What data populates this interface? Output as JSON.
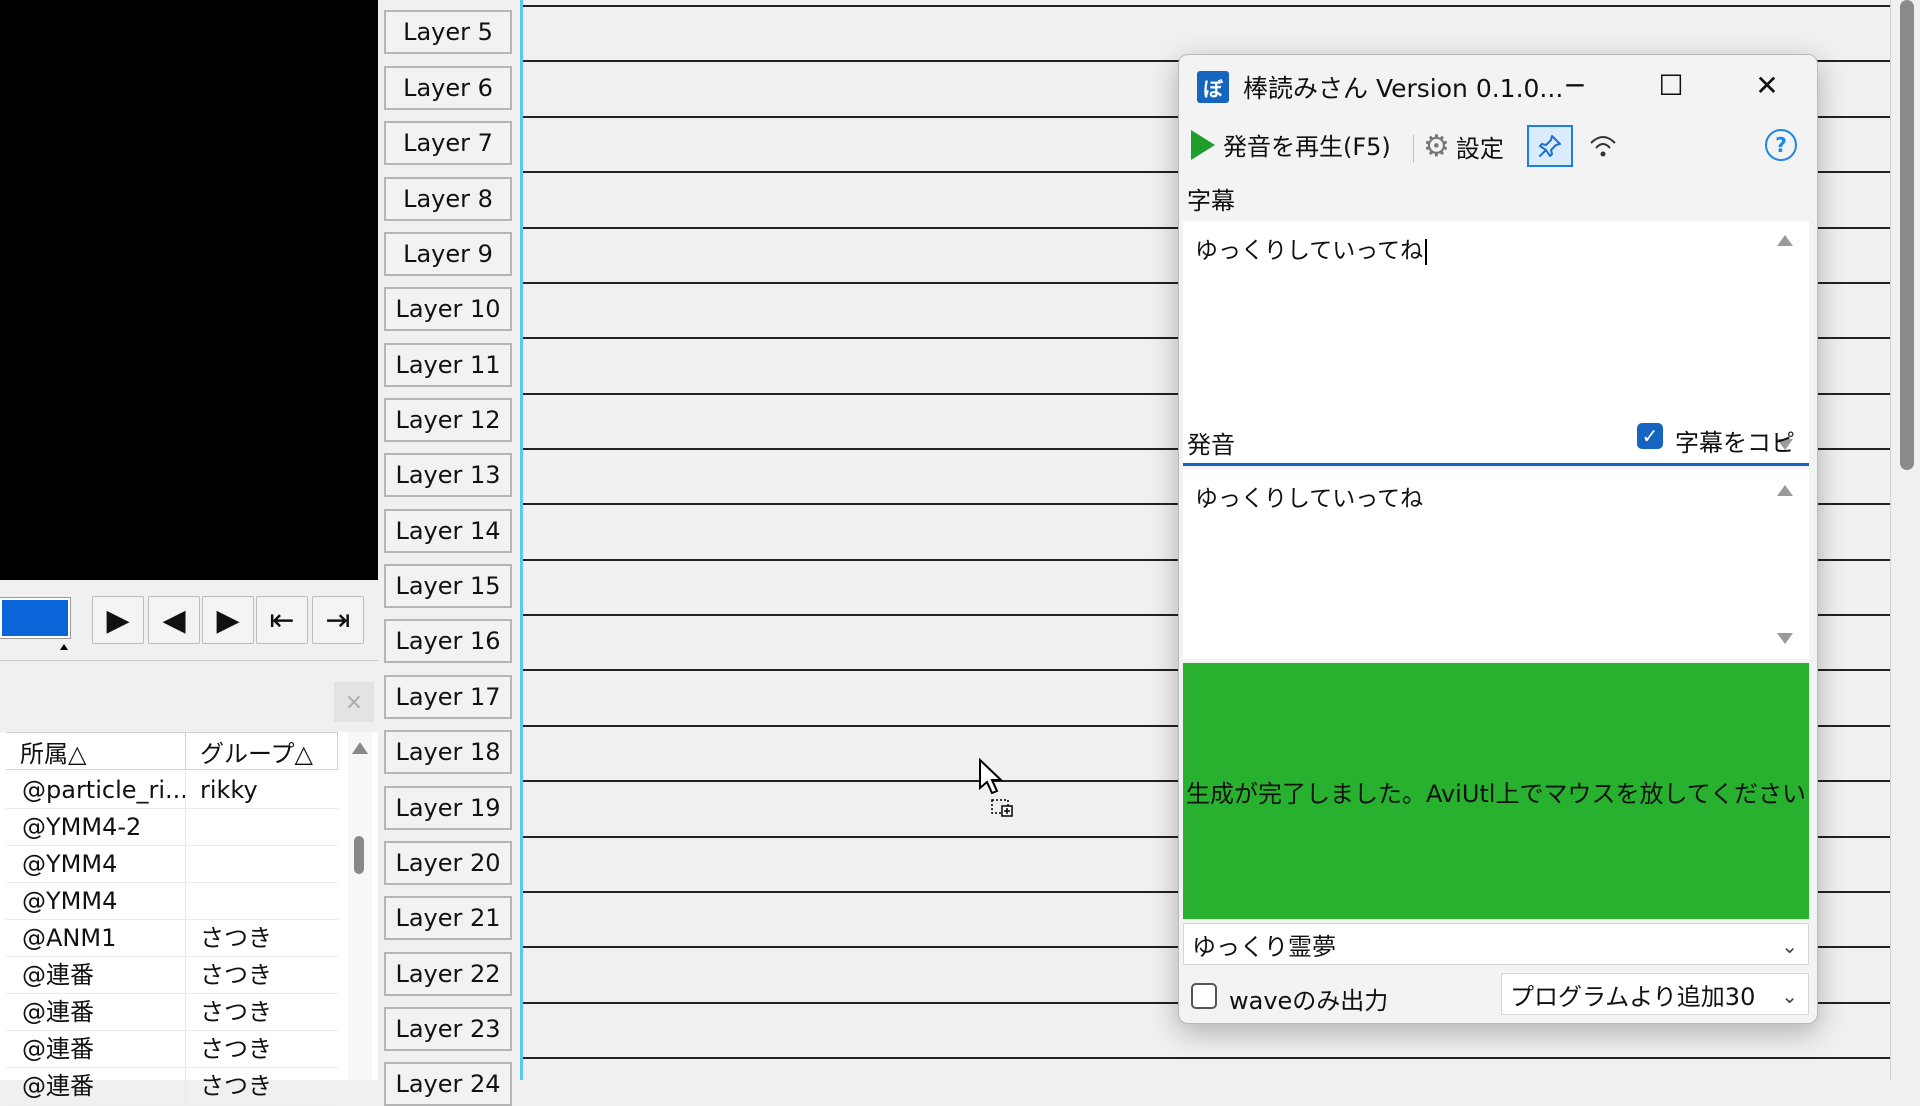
{
  "preview": {},
  "player_controls": [
    {
      "name": "play-button",
      "glyph": "▶"
    },
    {
      "name": "prev-frame-button",
      "glyph": "◀"
    },
    {
      "name": "next-frame-button",
      "glyph": "▶"
    },
    {
      "name": "jump-start-button",
      "glyph": "⇤"
    },
    {
      "name": "jump-end-button",
      "glyph": "⇥"
    }
  ],
  "object_list": {
    "close_glyph": "×",
    "headers": [
      "所属△",
      "グループ△"
    ],
    "rows": [
      [
        "@particle_ri...",
        "rikky"
      ],
      [
        "@YMM4-2",
        ""
      ],
      [
        "@YMM4",
        ""
      ],
      [
        "@YMM4",
        ""
      ],
      [
        "@ANM1",
        "さつき"
      ],
      [
        "@連番",
        "さつき"
      ],
      [
        "@連番",
        "さつき"
      ],
      [
        "@連番",
        "さつき"
      ],
      [
        "@連番",
        "さつき"
      ]
    ]
  },
  "timeline": {
    "layers": [
      "Layer 5",
      "Layer 6",
      "Layer 7",
      "Layer 8",
      "Layer 9",
      "Layer 10",
      "Layer 11",
      "Layer 12",
      "Layer 13",
      "Layer 14",
      "Layer 15",
      "Layer 16",
      "Layer 17",
      "Layer 18",
      "Layer 19",
      "Layer 20",
      "Layer 21",
      "Layer 22",
      "Layer 23",
      "Layer 24"
    ]
  },
  "dialog": {
    "title": "棒読みさん Version 0.1.0...",
    "icon_glyph": "ぼ",
    "window_controls": {
      "minimize": "─",
      "maximize": "☐",
      "close": "✕"
    },
    "toolbar": {
      "play_label": "発音を再生(F5)",
      "settings_label": "設定",
      "help_glyph": "?"
    },
    "subtitle": {
      "label": "字幕",
      "text": "ゆっくりしていってね"
    },
    "pronunciation": {
      "label": "発音",
      "copy_checkbox_label": "字幕をコピー",
      "copy_checked": true,
      "text": "ゆっくりしていってね"
    },
    "status_message": "生成が完了しました。AviUtl上でマウスを放してください",
    "status_color": "#28b12e",
    "voice_select": "ゆっくり霊夢",
    "wave_only_label": "waveのみ出力",
    "wave_only_checked": false,
    "layer_select": "プログラムより追加30"
  }
}
